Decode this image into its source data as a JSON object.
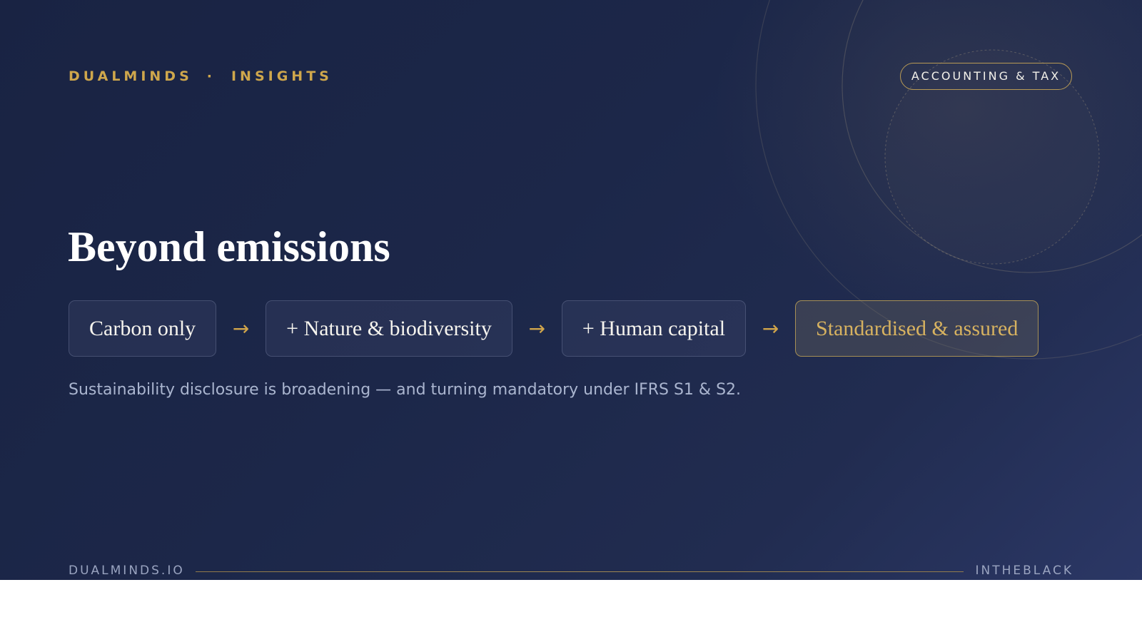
{
  "header": {
    "brand": "DUALMINDS",
    "separator": "·",
    "section": "INSIGHTS",
    "tag": "ACCOUNTING & TAX"
  },
  "main": {
    "title": "Beyond emissions",
    "steps": [
      {
        "label": "Carbon only"
      },
      {
        "label": "+ Nature & biodiversity"
      },
      {
        "label": "+ Human capital"
      },
      {
        "label": "Standardised & assured"
      }
    ],
    "arrow": "→",
    "subtitle": "Sustainability disclosure is broadening — and turning mandatory under IFRS S1 & S2."
  },
  "footer": {
    "left": "DUALMINDS.IO",
    "right": "INTHEBLACK"
  },
  "colors": {
    "background": "#1b2546",
    "accent_gold": "#cfa74c",
    "title": "#ffffff",
    "subtitle": "#aab5cf"
  }
}
